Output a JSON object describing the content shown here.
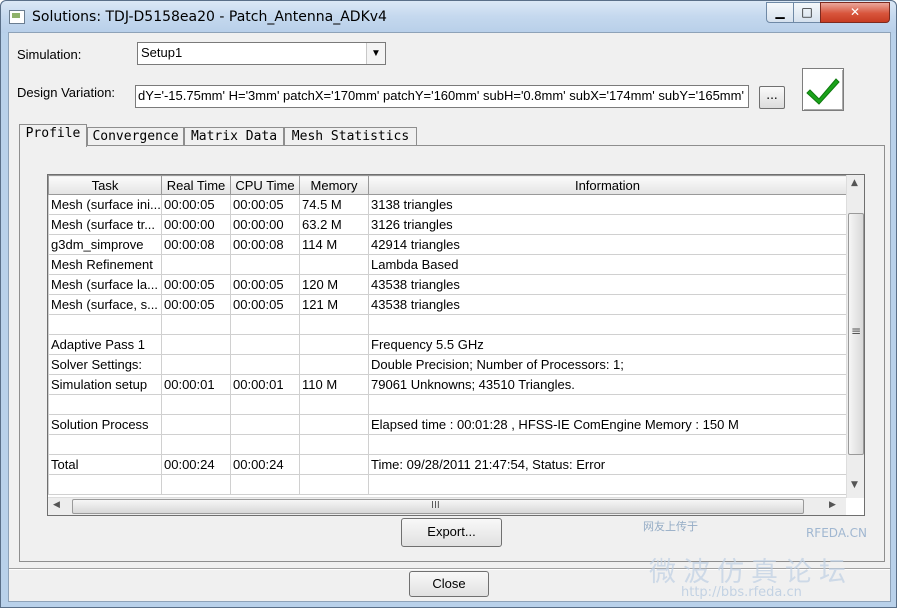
{
  "window": {
    "title": "Solutions: TDJ-D5158ea20 - Patch_Antenna_ADKv4",
    "controls": {
      "minimize": "▁",
      "maximize": "□",
      "close": "✕"
    }
  },
  "simulation": {
    "label": "Simulation:",
    "value": "Setup1"
  },
  "design_variation": {
    "label": "Design Variation:",
    "value": "dY='-15.75mm' H='3mm' patchX='170mm' patchY='160mm' subH='0.8mm' subX='174mm' subY='165mm'",
    "button_label": "..."
  },
  "status": {
    "icon": "checkmark-icon",
    "color": "#1aa31a"
  },
  "tabs": [
    "Profile",
    "Convergence",
    "Matrix Data",
    "Mesh Statistics"
  ],
  "profile_table": {
    "columns": [
      "Task",
      "Real Time",
      "CPU Time",
      "Memory",
      "Information"
    ],
    "rows": [
      [
        "Mesh (surface ini...",
        "00:00:05",
        "00:00:05",
        "74.5 M",
        "3138 triangles"
      ],
      [
        "Mesh (surface tr...",
        "00:00:00",
        "00:00:00",
        "63.2 M",
        "3126 triangles"
      ],
      [
        "g3dm_simprove",
        "00:00:08",
        "00:00:08",
        "114 M",
        "42914 triangles"
      ],
      [
        "Mesh Refinement",
        "",
        "",
        "",
        "Lambda Based"
      ],
      [
        "Mesh (surface la...",
        "00:00:05",
        "00:00:05",
        "120 M",
        "43538 triangles"
      ],
      [
        "Mesh (surface, s...",
        "00:00:05",
        "00:00:05",
        "121 M",
        "43538 triangles"
      ],
      [
        "",
        "",
        "",
        "",
        ""
      ],
      [
        "Adaptive Pass 1",
        "",
        "",
        "",
        "Frequency 5.5 GHz"
      ],
      [
        "Solver Settings:",
        "",
        "",
        "",
        "Double Precision;  Number of Processors: 1;"
      ],
      [
        "Simulation setup",
        "00:00:01",
        "00:00:01",
        "110 M",
        "79061 Unknowns; 43510 Triangles."
      ],
      [
        "",
        "",
        "",
        "",
        ""
      ],
      [
        "Solution Process",
        "",
        "",
        "",
        "Elapsed time : 00:01:28 , HFSS-IE ComEngine Memory : 150 M"
      ],
      [
        "",
        "",
        "",
        "",
        ""
      ],
      [
        "Total",
        "00:00:24",
        "00:00:24",
        "",
        "Time:  09/28/2011 21:47:54, Status: Error"
      ],
      [
        "",
        "",
        "",
        "",
        ""
      ]
    ]
  },
  "scroll": {
    "up": "▲",
    "down": "▼",
    "left": "◀",
    "right": "▶",
    "v_grip": "≡",
    "h_grip": "III"
  },
  "buttons": {
    "export": "Export...",
    "close": "Close"
  },
  "watermark": {
    "line1": "网友上传于",
    "line2": "RFEDA.CN",
    "line3": "微波仿真论坛",
    "line4": "http://bbs.rfeda.cn"
  }
}
